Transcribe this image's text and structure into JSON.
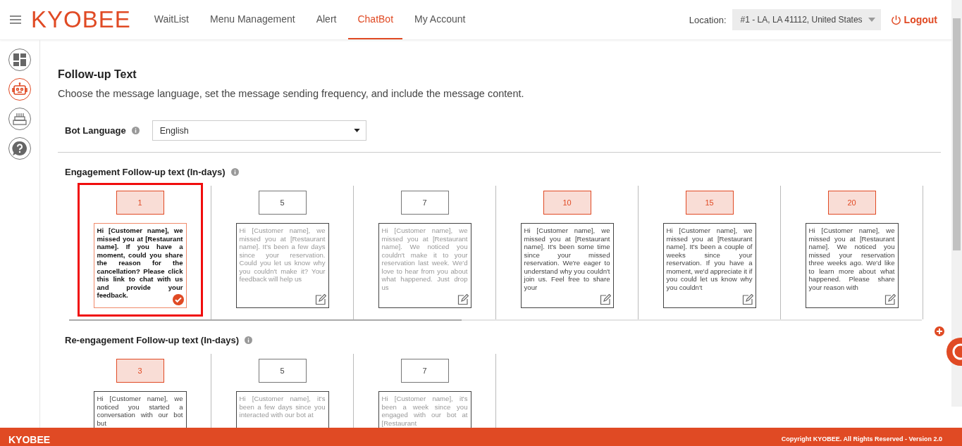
{
  "header": {
    "logo": "KYOBEE",
    "nav": [
      {
        "label": "WaitList",
        "selected": false
      },
      {
        "label": "Menu Management",
        "selected": false
      },
      {
        "label": "Alert",
        "selected": false
      },
      {
        "label": "ChatBot",
        "selected": true
      },
      {
        "label": "My Account",
        "selected": false
      }
    ],
    "location_label": "Location:",
    "location_value": "#1 - LA, LA 41112, United States",
    "logout": "Logout"
  },
  "sidebar": {
    "items": [
      {
        "kind": "dashboard",
        "selected": false
      },
      {
        "kind": "bot",
        "selected": true
      },
      {
        "kind": "cake",
        "selected": false
      },
      {
        "kind": "help",
        "selected": false
      }
    ]
  },
  "page": {
    "title": "Follow-up Text",
    "description": "Choose the message language, set the message sending frequency, and include the message content.",
    "bot_language_label": "Bot Language",
    "bot_language_value": "English"
  },
  "sections": [
    {
      "title": "Engagement Follow-up text (In-days)",
      "items": [
        {
          "day": "1",
          "active": true,
          "selected": true,
          "message": "Hi [Customer name], we missed you at [Restaurant name]. If you have a moment, could you share the reason for the cancellation? Please click this link to chat with us and provide your feedback."
        },
        {
          "day": "5",
          "active": false,
          "selected": false,
          "message": "Hi [Customer name], we missed you at [Restaurant name]. It's been a few days since your reservation. Could you let us know why you couldn't make it? Your feedback will help us"
        },
        {
          "day": "7",
          "active": false,
          "selected": false,
          "message": "Hi [Customer name], we missed you at [Restaurant name]. We noticed you couldn't make it to your reservation last week. We'd love to hear from you about what happened. Just drop us"
        },
        {
          "day": "10",
          "active": true,
          "selected": false,
          "message": "Hi [Customer name], we missed you at [Restaurant name]. It's been some time since your missed reservation. We're eager to understand why you couldn't join us. Feel free to share your"
        },
        {
          "day": "15",
          "active": true,
          "selected": false,
          "message": "Hi [Customer name], we missed you at [Restaurant name]. It's been a couple of weeks since your reservation. If you have a moment, we'd appreciate it if you could let us know why you couldn't"
        },
        {
          "day": "20",
          "active": true,
          "selected": false,
          "message": "Hi [Customer name], we missed you at [Restaurant name]. We noticed you missed your reservation three weeks ago. We'd like to learn more about what happened. Please share your reason with"
        }
      ]
    },
    {
      "title": "Re-engagement Follow-up text (In-days)",
      "items": [
        {
          "day": "3",
          "active": true,
          "selected": false,
          "message": "Hi [Customer name], we noticed you started a conversation with our bot but"
        },
        {
          "day": "5",
          "active": false,
          "selected": false,
          "message": "Hi [Customer name], it's been a few days since you interacted with our bot at"
        },
        {
          "day": "7",
          "active": false,
          "selected": false,
          "message": "Hi [Customer name], it's been a week since you engaged with our bot at [Restaurant"
        }
      ]
    }
  ],
  "footer": {
    "brand": "KYOBEE",
    "copyright": "Copyright KYOBEE. All Rights Reserved - Version 2.0"
  }
}
